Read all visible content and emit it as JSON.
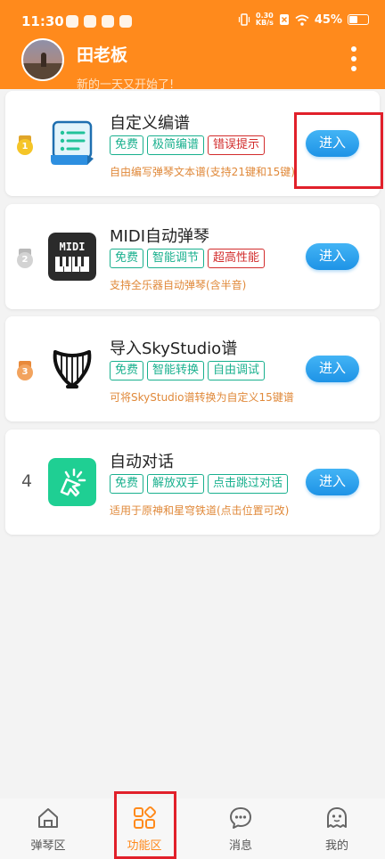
{
  "status_bar": {
    "time": "11:30",
    "net_speed_value": "0.30",
    "net_speed_unit": "KB/s",
    "battery_percent": "45%",
    "battery_level": 0.45
  },
  "header": {
    "username": "田老板",
    "greeting": "新的一天又开始了!",
    "bg_color": "#ff8a1c"
  },
  "cards": [
    {
      "rank": "1",
      "title": "自定义编谱",
      "tags": [
        "免费",
        "极简编谱",
        "错误提示"
      ],
      "desc": "自由编写弹琴文本谱(支持21键和15键)",
      "button": "进入",
      "icon": "sheet-editor-icon"
    },
    {
      "rank": "2",
      "title": "MIDI自动弹琴",
      "tags": [
        "免费",
        "智能调节",
        "超高性能"
      ],
      "desc": "支持全乐器自动弹琴(含半音)",
      "button": "进入",
      "icon": "midi-keyboard-icon",
      "icon_text": "MIDI"
    },
    {
      "rank": "3",
      "title": "导入SkyStudio谱",
      "tags": [
        "免费",
        "智能转换",
        "自由调试"
      ],
      "desc": "可将SkyStudio谱转换为自定义15键谱",
      "button": "进入",
      "icon": "harp-icon"
    },
    {
      "rank": "4",
      "title": "自动对话",
      "tags": [
        "免费",
        "解放双手",
        "点击跳过对话"
      ],
      "desc": "适用于原神和星穹铁道(点击位置可改)",
      "button": "进入",
      "icon": "tap-cursor-icon"
    }
  ],
  "bottom_nav": [
    {
      "label": "弹琴区",
      "icon": "home-icon",
      "active": false
    },
    {
      "label": "功能区",
      "icon": "grid-icon",
      "active": true
    },
    {
      "label": "消息",
      "icon": "chat-icon",
      "active": false
    },
    {
      "label": "我的",
      "icon": "profile-icon",
      "active": false
    }
  ],
  "colors": {
    "accent": "#ff8a1c",
    "tag_green": "#19b08e",
    "tag_red": "#d22c2c",
    "desc_orange": "#e0893a",
    "button_blue": "#1e93e6",
    "highlight_red": "#e1202a"
  }
}
